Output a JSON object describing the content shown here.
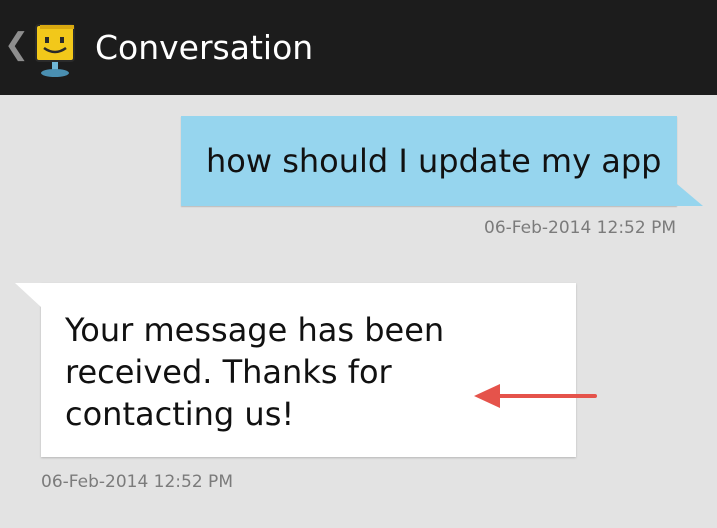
{
  "action_bar": {
    "back_icon": "chevron-left-icon",
    "app_icon": "smiley-sign-icon",
    "title": "Conversation"
  },
  "messages": [
    {
      "direction": "outgoing",
      "text": "how should I update my app",
      "timestamp": "06-Feb-2014 12:52 PM"
    },
    {
      "direction": "incoming",
      "text": "Your message has been received. Thanks for contacting us!",
      "timestamp": "06-Feb-2014 12:52 PM"
    }
  ],
  "colors": {
    "action_bar": "#1c1c1c",
    "background": "#e3e3e3",
    "outgoing_bubble": "#96d5ee",
    "incoming_bubble": "#ffffff",
    "annotation_arrow": "#e5534b"
  }
}
